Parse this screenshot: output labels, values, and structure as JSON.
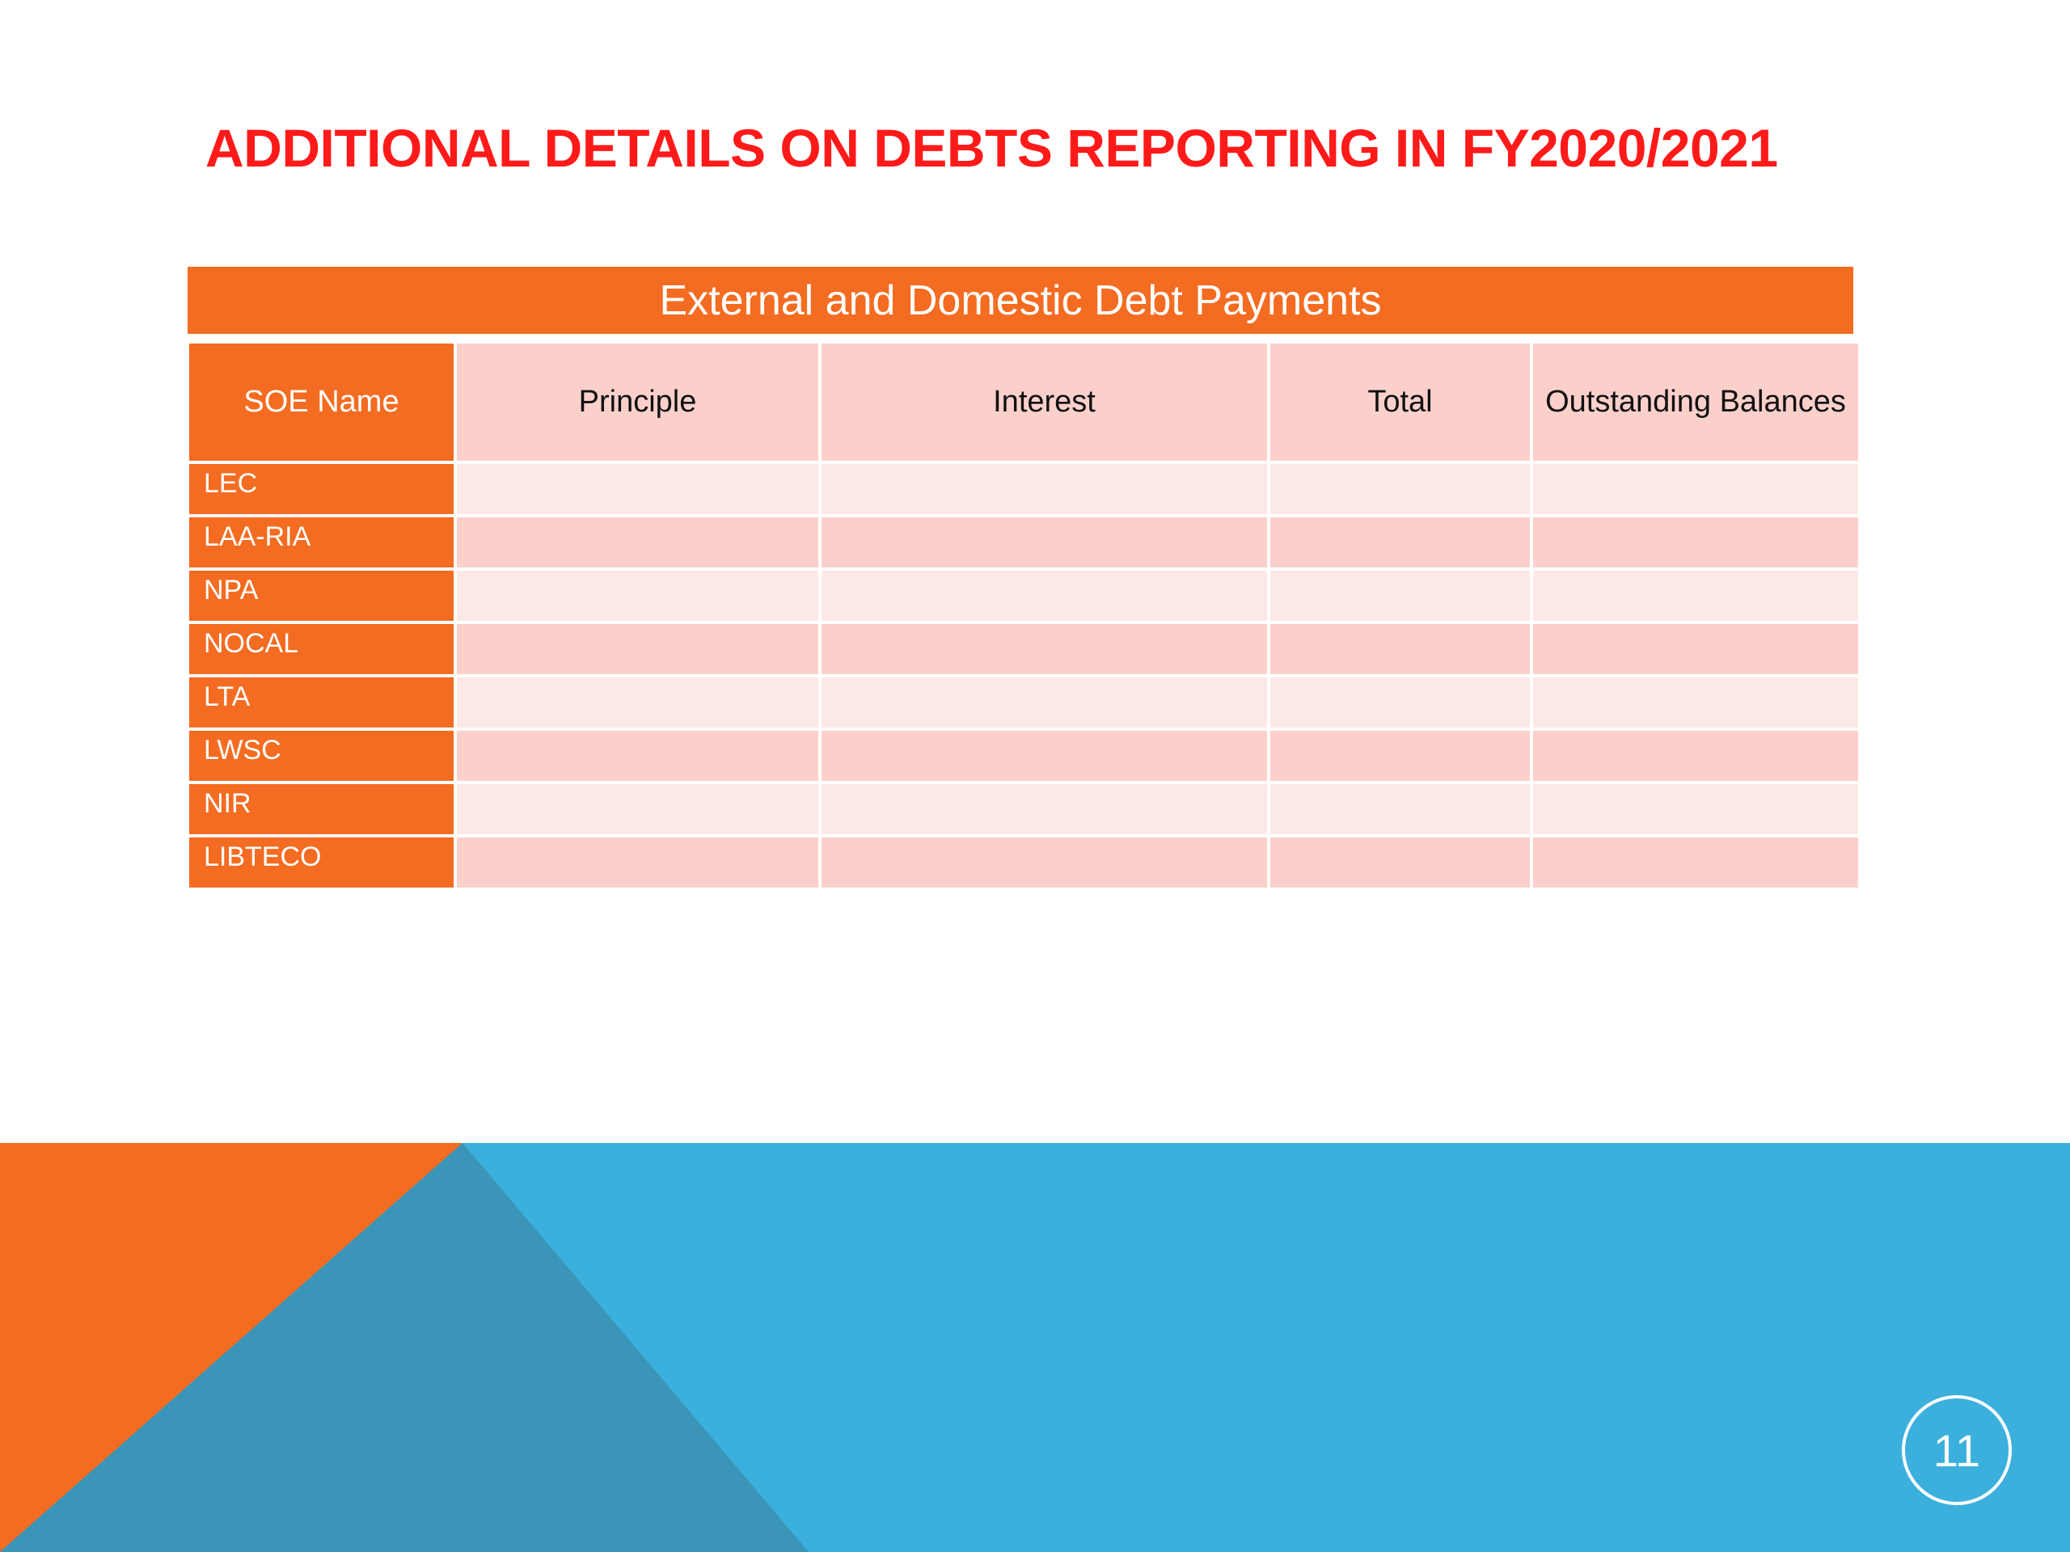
{
  "slide": {
    "title": "ADDITIONAL DETAILS ON DEBTS REPORTING IN FY2020/2021",
    "page_number": "11"
  },
  "table": {
    "caption": "External and Domestic Debt Payments",
    "columns": [
      "SOE Name",
      "Principle",
      "Interest",
      "Total",
      "Outstanding Balances"
    ],
    "rows": [
      {
        "soe": "LEC",
        "principle": "",
        "interest": "",
        "total": "",
        "outstanding": ""
      },
      {
        "soe": "LAA-RIA",
        "principle": "",
        "interest": "",
        "total": "",
        "outstanding": ""
      },
      {
        "soe": "NPA",
        "principle": "",
        "interest": "",
        "total": "",
        "outstanding": ""
      },
      {
        "soe": "NOCAL",
        "principle": "",
        "interest": "",
        "total": "",
        "outstanding": ""
      },
      {
        "soe": "LTA",
        "principle": "",
        "interest": "",
        "total": "",
        "outstanding": ""
      },
      {
        "soe": "LWSC",
        "principle": "",
        "interest": "",
        "total": "",
        "outstanding": ""
      },
      {
        "soe": "NIR",
        "principle": "",
        "interest": "",
        "total": "",
        "outstanding": ""
      },
      {
        "soe": "LIBTECO",
        "principle": "",
        "interest": "",
        "total": "",
        "outstanding": ""
      }
    ]
  },
  "colors": {
    "title": "#ff1a1a",
    "orange": "#f36c21",
    "header_cell": "#fbd0cb",
    "row_light": "#fce9e6",
    "row_dark": "#fbd0cb",
    "blue": "#3bb0dd",
    "blue_dark": "#3a95b8"
  }
}
